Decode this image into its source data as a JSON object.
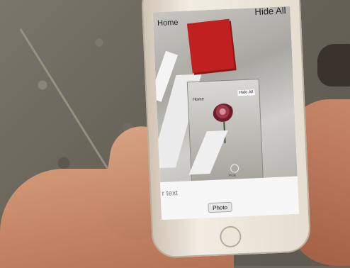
{
  "app": {
    "nav": {
      "home_label": "Home",
      "hide_all_label": "Hide All"
    },
    "inner_preview": {
      "home_label": "Home",
      "hide_all_label": "Hide All"
    },
    "text_input": {
      "placeholder": "r text"
    },
    "photo_button": {
      "label": "Photo"
    }
  },
  "colors": {
    "red_square": "#c0201f"
  }
}
